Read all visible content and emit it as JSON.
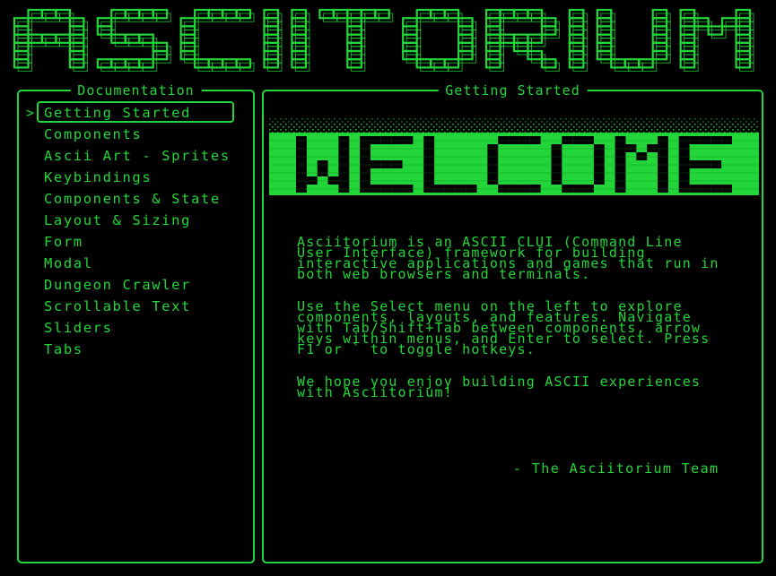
{
  "app": {
    "logo_text": "ASCIITORIUM"
  },
  "colors": {
    "background": "#000000",
    "accent": "#22d63a",
    "accent_dark": "#0f7a1c"
  },
  "sidebar": {
    "title": "Documentation",
    "selected_index": 0,
    "caret": ">",
    "items": [
      {
        "label": "Getting Started"
      },
      {
        "label": "Components"
      },
      {
        "label": "Ascii Art - Sprites"
      },
      {
        "label": "Keybindings"
      },
      {
        "label": "Components & State"
      },
      {
        "label": "Layout & Sizing"
      },
      {
        "label": "Form"
      },
      {
        "label": "Modal"
      },
      {
        "label": "Dungeon Crawler"
      },
      {
        "label": "Scrollable Text"
      },
      {
        "label": "Sliders"
      },
      {
        "label": "Tabs"
      }
    ]
  },
  "main": {
    "title": "Getting Started",
    "welcome_art_text": "WELCOME",
    "paragraphs": [
      "Asciitorium is an ASCII CLUI (Command Line\nUser Interface) framework for building\ninteractive applications and games that run in\nboth web browsers and terminals.",
      "Use the Select menu on the left to explore\ncomponents, layouts, and features. Navigate\nwith Tab/Shift+Tab between components, arrow\nkeys within menus, and Enter to select. Press\nF1 or ` to toggle hotkeys.",
      "We hope you enjoy building ASCII experiences\nwith Asciitorium!"
    ],
    "signature": "- The Asciitorium Team"
  }
}
